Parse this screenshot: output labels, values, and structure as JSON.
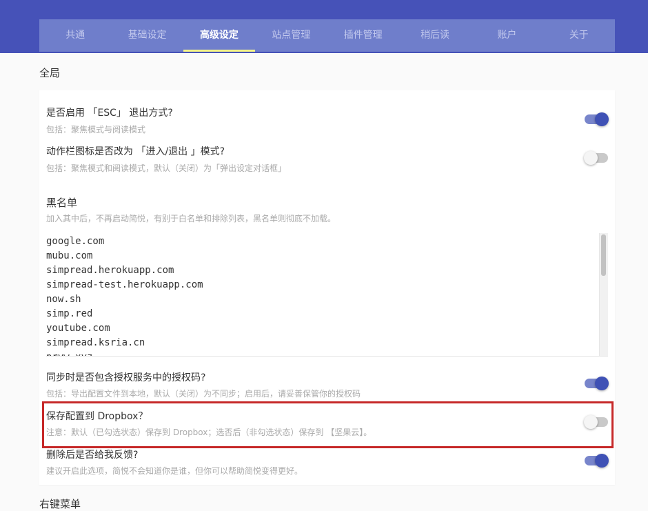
{
  "tabs": [
    {
      "label": "共通",
      "active": false
    },
    {
      "label": "基础设定",
      "active": false
    },
    {
      "label": "高级设定",
      "active": true
    },
    {
      "label": "站点管理",
      "active": false
    },
    {
      "label": "插件管理",
      "active": false
    },
    {
      "label": "稍后读",
      "active": false
    },
    {
      "label": "账户",
      "active": false
    },
    {
      "label": "关于",
      "active": false
    }
  ],
  "section_title": "全局",
  "options": [
    {
      "title": "是否启用 「ESC」 退出方式?",
      "desc": "包括：聚焦模式与阅读模式",
      "enabled": true
    },
    {
      "title": "动作栏图标是否改为 「进入/退出 」模式?",
      "desc": "包括：聚焦模式和阅读模式，默认（关闭）为「弹出设定对话框」",
      "enabled": false
    }
  ],
  "blacklist": {
    "title": "黑名单",
    "desc": "加入其中后，不再启动简悦，有别于白名单和排除列表，黑名单则彻底不加载。",
    "items": [
      "google.com",
      "mubu.com",
      "simpread.herokuapp.com",
      "simpread-test.herokuapp.com",
      "now.sh",
      "simp.red",
      "youtube.com",
      "simpread.ksria.cn",
      "prvw.xyz"
    ]
  },
  "options2": [
    {
      "title": "同步时是否包含授权服务中的授权码?",
      "desc": "包括：导出配置文件到本地，默认（关闭）为不同步；启用后，请妥善保管你的授权码",
      "enabled": true
    },
    {
      "title": "保存配置到 Dropbox？",
      "desc": "注意：默认（已勾选状态）保存到 Dropbox；选否后（非勾选状态）保存到 【坚果云】。",
      "enabled": false
    },
    {
      "title": "删除后是否给我反馈?",
      "desc": "建议开启此选项，简悦不会知道你是谁，但你可以帮助简悦变得更好。",
      "enabled": true
    }
  ],
  "next_section_title": "右键菜单",
  "colors": {
    "header": "#4652b8",
    "tabbar": "#6f7ecb",
    "tab_indicator": "#f5f58a",
    "toggle_on": "#3f51b5",
    "highlight": "#c62828"
  }
}
